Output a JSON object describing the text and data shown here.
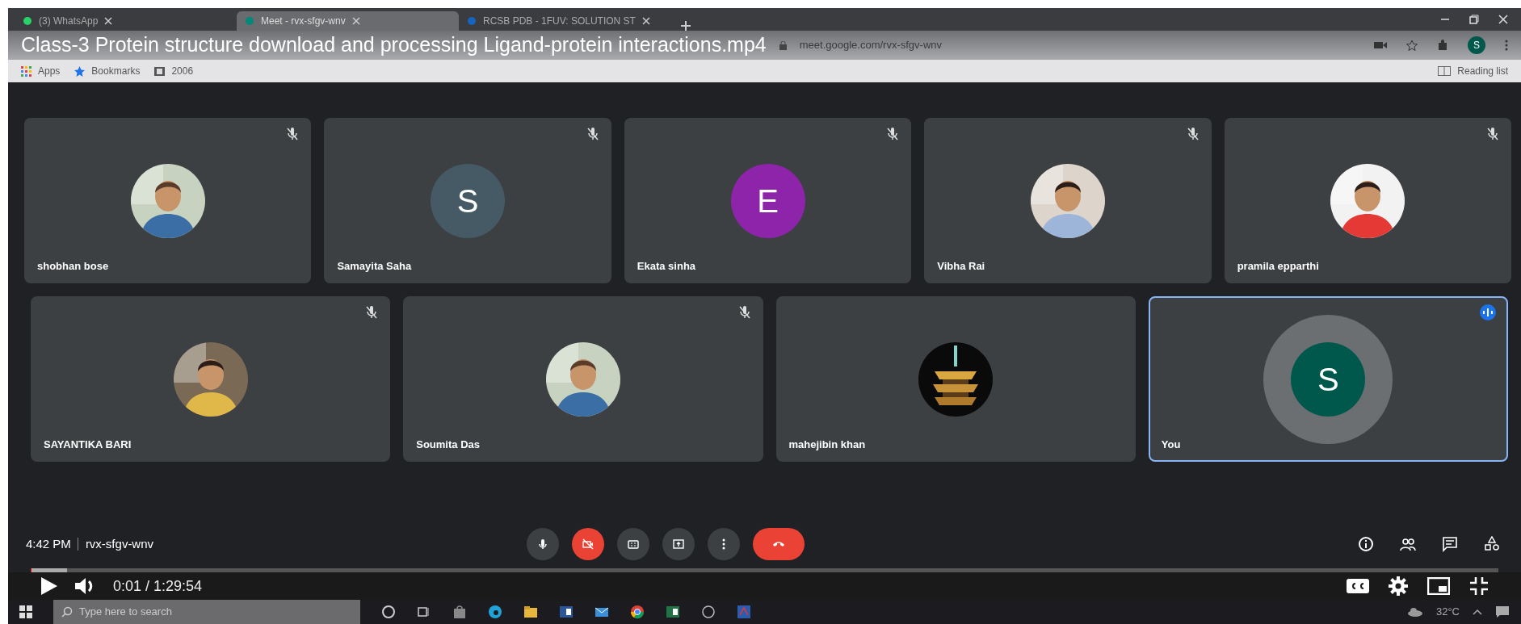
{
  "video_title": "Class-3 Protein structure download and processing Ligand-protein interactions.mp4",
  "browser": {
    "tabs": [
      {
        "label": "(3) WhatsApp",
        "selected": false
      },
      {
        "label": "Meet - rvx-sfgv-wnv",
        "selected": true
      },
      {
        "label": "RCSB PDB - 1FUV: SOLUTION ST",
        "selected": false
      }
    ],
    "address": "meet.google.com/rvx-sfgv-wnv",
    "profile_letter": "S",
    "bookmarks": [
      "Apps",
      "Bookmarks",
      "2006"
    ],
    "reading_list": "Reading list"
  },
  "participants": [
    {
      "name": "shobhan bose",
      "kind": "picture",
      "muted": true,
      "speaking": false
    },
    {
      "name": "Samayita Saha",
      "kind": "letter",
      "letter": "S",
      "color": "#455a64",
      "muted": true,
      "speaking": false
    },
    {
      "name": "Ekata sinha",
      "kind": "letter",
      "letter": "E",
      "color": "#8e24aa",
      "muted": true,
      "speaking": false
    },
    {
      "name": "Vibha Rai",
      "kind": "picture",
      "muted": true,
      "speaking": false
    },
    {
      "name": "pramila epparthi",
      "kind": "picture",
      "muted": true,
      "speaking": false
    },
    {
      "name": "SAYANTIKA BARI",
      "kind": "picture",
      "muted": true,
      "speaking": false
    },
    {
      "name": "Soumita Das",
      "kind": "picture",
      "muted": true,
      "speaking": false
    },
    {
      "name": "mahejibin khan",
      "kind": "picture",
      "muted": false,
      "speaking": false
    },
    {
      "name": "You",
      "kind": "letter",
      "letter": "S",
      "color": "#00574b",
      "muted": false,
      "speaking": true
    }
  ],
  "meet_bar": {
    "time": "4:42 PM",
    "meeting_code": "rvx-sfgv-wnv",
    "controls": [
      {
        "kind": "mic",
        "off": false
      },
      {
        "kind": "camera",
        "off": true
      },
      {
        "kind": "captions"
      },
      {
        "kind": "present"
      },
      {
        "kind": "more"
      },
      {
        "kind": "end_call"
      }
    ],
    "side_buttons": [
      {
        "kind": "info"
      },
      {
        "kind": "people"
      },
      {
        "kind": "chat"
      },
      {
        "kind": "activities"
      }
    ]
  },
  "player": {
    "level": 0.0002,
    "time": "0:01 / 1:29:54"
  },
  "taskbar": {
    "search_placeholder": "Type here to search",
    "temperature": "32°C"
  }
}
